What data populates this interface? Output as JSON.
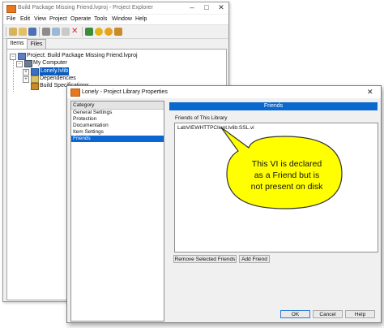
{
  "explorer": {
    "title": "Build Package Missing Friend.lvproj - Project Explorer",
    "menu": [
      "File",
      "Edit",
      "View",
      "Project",
      "Operate",
      "Tools",
      "Window",
      "Help"
    ],
    "tabs": [
      "Items",
      "Files"
    ],
    "active_tab": "Items",
    "tree": {
      "project": "Project: Build Package Missing Friend.lvproj",
      "computer": "My Computer",
      "library": "Lonely.lvlib",
      "dependencies": "Dependencies",
      "build_specs": "Build Specifications"
    }
  },
  "dialog": {
    "title": "Lonely - Project Library Properties",
    "category_header": "Category",
    "categories": [
      "General Settings",
      "Protection",
      "Documentation",
      "Item Settings",
      "Friends"
    ],
    "selected_category": "Friends",
    "banner": "Friends",
    "friends_label": "Friends of This Library",
    "friends": [
      "LabVIEWHTTPClient.lvlib:SSL.vi"
    ],
    "remove_button": "Remove Selected Friends",
    "add_button": "Add Friend",
    "ok": "OK",
    "cancel": "Cancel",
    "help": "Help"
  },
  "callout": {
    "lines": [
      "This VI is declared",
      "as a Friend but is",
      "not present on disk"
    ],
    "color": "#ffff00"
  },
  "colors": {
    "selection_blue": "#0b66d1",
    "labview_orange": "#e87722"
  }
}
